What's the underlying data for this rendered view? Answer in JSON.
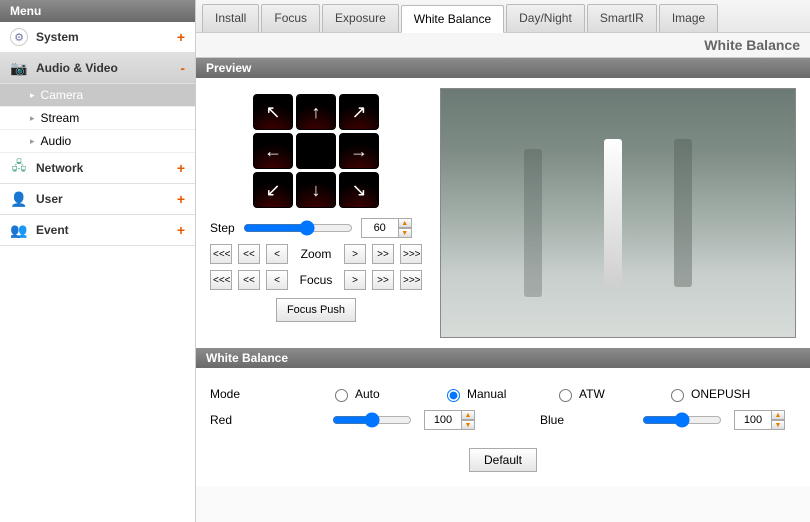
{
  "sidebar": {
    "title": "Menu",
    "items": [
      {
        "label": "System",
        "icon": "system",
        "expand": "+"
      },
      {
        "label": "Audio & Video",
        "icon": "av",
        "expand": "-",
        "active": true,
        "sub": [
          {
            "label": "Camera",
            "active": true
          },
          {
            "label": "Stream"
          },
          {
            "label": "Audio"
          }
        ]
      },
      {
        "label": "Network",
        "icon": "net",
        "expand": "+"
      },
      {
        "label": "User",
        "icon": "user",
        "expand": "+"
      },
      {
        "label": "Event",
        "icon": "event",
        "expand": "+"
      }
    ]
  },
  "tabs": {
    "items": [
      "Install",
      "Focus",
      "Exposure",
      "White Balance",
      "Day/Night",
      "SmartIR",
      "Image"
    ],
    "active": "White Balance"
  },
  "page": {
    "title": "White Balance"
  },
  "preview": {
    "title": "Preview",
    "step_label": "Step",
    "step_value": "60",
    "zoom_label": "Zoom",
    "focus_label": "Focus",
    "nav": {
      "b3": "<<<",
      "b2": "<<",
      "b1": "<",
      "f1": ">",
      "f2": ">>",
      "f3": ">>>"
    },
    "focus_push": "Focus Push",
    "arrows": {
      "nw": "↖",
      "n": "↑",
      "ne": "↗",
      "w": "←",
      "e": "→",
      "sw": "↙",
      "s": "↓",
      "se": "↘"
    }
  },
  "wb": {
    "title": "White Balance",
    "mode_label": "Mode",
    "modes": {
      "auto": "Auto",
      "manual": "Manual",
      "atw": "ATW",
      "onepush": "ONEPUSH"
    },
    "mode_selected": "manual",
    "red_label": "Red",
    "red_value": "100",
    "blue_label": "Blue",
    "blue_value": "100",
    "default_btn": "Default"
  }
}
